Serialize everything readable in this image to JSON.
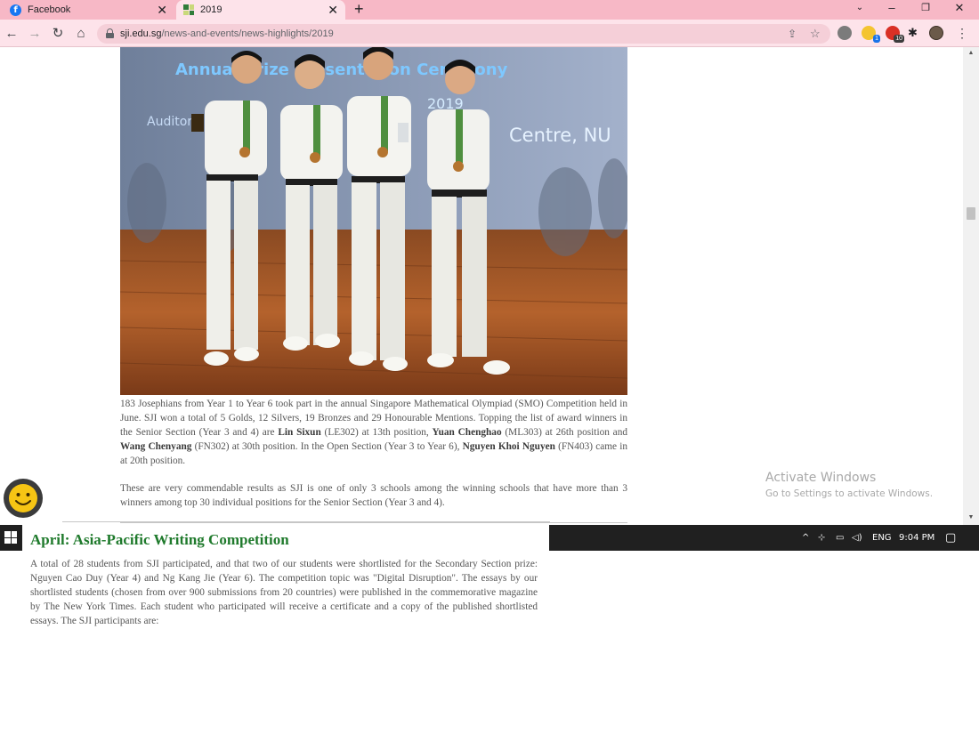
{
  "tabs": [
    {
      "title": "Facebook",
      "icon": "facebook-icon"
    },
    {
      "title": "2019",
      "icon": "sji-favicon",
      "active": true
    }
  ],
  "toolbar": {
    "url_host": "sji.edu.sg",
    "url_path": "/news-and-events/news-highlights/2019",
    "ext_badge_1": "1",
    "ext_badge_2": "10"
  },
  "photo": {
    "banner_line1": "Annual Prize Presentation Ceremony",
    "banner_line2": "2019",
    "banner_left": "Auditorium",
    "banner_right": "Centre, NU"
  },
  "article": {
    "p1_a": "183 Josephians from Year 1 to Year 6 took part in the annual Singapore Mathematical Olympiad (SMO) Competition held in June. SJI won a total of 5 Golds, 12 Silvers, 19 Bronzes and 29 Honourable Mentions. Topping the list of award winners in the Senior Section (Year 3 and 4) are ",
    "p1_name1": "Lin Sixun",
    "p1_b": " (LE302) at 13th position, ",
    "p1_name2": "Yuan Chenghao",
    "p1_c": " (ML303) at 26th position and ",
    "p1_name3": "Wang Chenyang",
    "p1_d": " (FN302) at 30th position. In the Open Section (Year 3 to Year 6), ",
    "p1_name4": "Nguyen Khoi Nguyen",
    "p1_e": " (FN403) came in at 20th position.",
    "p2": "These are very commendable results as SJI is one of only 3 schools among the winning schools that have more than 3 winners among top 30 individual positions for the Senior Section (Year 3 and 4)."
  },
  "activate_windows": {
    "title": "Activate Windows",
    "subtitle": "Go to Settings to activate Windows."
  },
  "taskbar": {
    "language": "ENG",
    "time": "9:04 PM"
  },
  "section": {
    "title": "April: Asia-Pacific Writing Competition",
    "body": "A total of 28 students from SJI participated, and that two of our students were shortlisted for the Secondary Section prize: Nguyen Cao Duy (Year 4) and Ng Kang Jie (Year 6). The competition topic was \"Digital Disruption\". The essays by our shortlisted students (chosen from over 900 submissions from 20 countries) were published in the commemorative magazine by The New York Times. Each student who participated will receive a certificate and a copy of the published shortlisted essays. The SJI participants are:"
  },
  "colors": {
    "tabbar": "#f7b8c6",
    "toolbar": "#fde3ea",
    "section_title": "#1f7a2c",
    "taskbar": "#202020"
  }
}
